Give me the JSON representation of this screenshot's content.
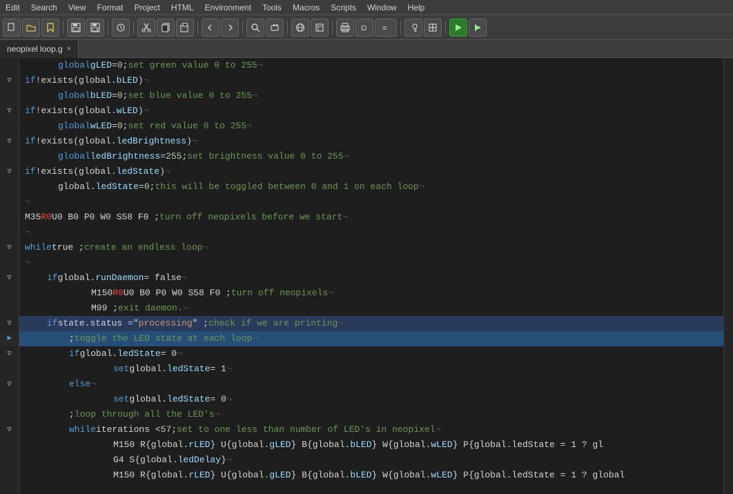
{
  "menubar": {
    "items": [
      "Edit",
      "Search",
      "View",
      "Format",
      "Project",
      "HTML",
      "Environment",
      "Tools",
      "Macros",
      "Scripts",
      "Window",
      "Help"
    ]
  },
  "toolbar": {
    "buttons": [
      "new",
      "open",
      "bookmark",
      "save",
      "saveas",
      "undo-history",
      "cut",
      "copy",
      "paste",
      "back",
      "forward",
      "search",
      "plugin",
      "browser",
      "tools1",
      "tools2",
      "tools3",
      "tools4",
      "tools5",
      "run",
      "run-more"
    ]
  },
  "tab": {
    "filename": "neopixel loop.g",
    "close_label": "×"
  },
  "code": {
    "lines": [
      {
        "indent": 1,
        "tokens": [
          {
            "t": "kw",
            "v": "global"
          },
          {
            "t": "plain",
            "v": " "
          },
          {
            "t": "var",
            "v": "gLED"
          },
          {
            "t": "plain",
            "v": " = "
          },
          {
            "t": "num",
            "v": "0"
          },
          {
            "t": "plain",
            "v": " ; "
          },
          {
            "t": "cmt",
            "v": "set green value 0 to 255"
          },
          {
            "t": "plain",
            "v": "¬"
          }
        ]
      },
      {
        "indent": 0,
        "fold": "▽",
        "tokens": [
          {
            "t": "kw",
            "v": "if"
          },
          {
            "t": "plain",
            "v": " !exists(global."
          },
          {
            "t": "var",
            "v": "bLED"
          },
          {
            "t": "plain",
            "v": ")¬"
          }
        ]
      },
      {
        "indent": 1,
        "tokens": [
          {
            "t": "kw",
            "v": "global"
          },
          {
            "t": "plain",
            "v": " "
          },
          {
            "t": "var",
            "v": "bLED"
          },
          {
            "t": "plain",
            "v": " = "
          },
          {
            "t": "num",
            "v": "0"
          },
          {
            "t": "plain",
            "v": " ; "
          },
          {
            "t": "cmt",
            "v": "set blue value 0 to 255"
          },
          {
            "t": "plain",
            "v": "¬"
          }
        ]
      },
      {
        "indent": 0,
        "fold": "▽",
        "tokens": [
          {
            "t": "kw",
            "v": "if"
          },
          {
            "t": "plain",
            "v": " !exists(global."
          },
          {
            "t": "var",
            "v": "wLED"
          },
          {
            "t": "plain",
            "v": ")¬"
          }
        ]
      },
      {
        "indent": 1,
        "tokens": [
          {
            "t": "kw",
            "v": "global"
          },
          {
            "t": "plain",
            "v": " "
          },
          {
            "t": "var",
            "v": "wLED"
          },
          {
            "t": "plain",
            "v": " = "
          },
          {
            "t": "num",
            "v": "0"
          },
          {
            "t": "plain",
            "v": " ; "
          },
          {
            "t": "cmt",
            "v": "set red value 0 to 255"
          },
          {
            "t": "plain",
            "v": "¬"
          }
        ]
      },
      {
        "indent": 0,
        "fold": "▽",
        "tokens": [
          {
            "t": "kw",
            "v": "if"
          },
          {
            "t": "plain",
            "v": " !exists(global."
          },
          {
            "t": "var",
            "v": "ledBrightness"
          },
          {
            "t": "plain",
            "v": ")¬"
          }
        ]
      },
      {
        "indent": 1,
        "tokens": [
          {
            "t": "kw",
            "v": "global"
          },
          {
            "t": "plain",
            "v": " "
          },
          {
            "t": "var",
            "v": "ledBrightness"
          },
          {
            "t": "plain",
            "v": " = "
          },
          {
            "t": "num",
            "v": "255"
          },
          {
            "t": "plain",
            "v": " ; "
          },
          {
            "t": "cmt",
            "v": "set brightness value 0 to 255"
          },
          {
            "t": "plain",
            "v": "¬"
          }
        ]
      },
      {
        "indent": 0,
        "fold": "▽",
        "tokens": [
          {
            "t": "kw",
            "v": "if"
          },
          {
            "t": "plain",
            "v": " !exists(global."
          },
          {
            "t": "var",
            "v": "ledState"
          },
          {
            "t": "plain",
            "v": ")¬"
          }
        ]
      },
      {
        "indent": 1,
        "tokens": [
          {
            "t": "plain",
            "v": "global."
          },
          {
            "t": "var",
            "v": "ledState"
          },
          {
            "t": "plain",
            "v": " = "
          },
          {
            "t": "num",
            "v": "0"
          },
          {
            "t": "plain",
            "v": " ; "
          },
          {
            "t": "cmt",
            "v": "this will be toggled between 0 and 1 on each loop"
          },
          {
            "t": "plain",
            "v": "¬"
          }
        ]
      },
      {
        "indent": 0,
        "tokens": [
          {
            "t": "plain",
            "v": "¬"
          }
        ]
      },
      {
        "indent": 0,
        "tokens": [
          {
            "t": "plain",
            "v": "M35 "
          },
          {
            "t": "kw-red",
            "v": "R0"
          },
          {
            "t": "plain",
            "v": " U0 B0 P0 W0 S58 F0  ; "
          },
          {
            "t": "cmt",
            "v": "turn off neopixels before we start"
          },
          {
            "t": "plain",
            "v": "¬"
          }
        ]
      },
      {
        "indent": 0,
        "tokens": [
          {
            "t": "plain",
            "v": "¬"
          }
        ]
      },
      {
        "indent": 0,
        "fold": "▽",
        "tokens": [
          {
            "t": "kw",
            "v": "while"
          },
          {
            "t": "plain",
            "v": " true ; "
          },
          {
            "t": "cmt",
            "v": "create an endless loop"
          },
          {
            "t": "plain",
            "v": "¬"
          }
        ]
      },
      {
        "indent": 0,
        "tokens": [
          {
            "t": "plain",
            "v": "¬"
          }
        ]
      },
      {
        "indent": 1,
        "fold": "▽",
        "tokens": [
          {
            "t": "kw",
            "v": "if"
          },
          {
            "t": "plain",
            "v": " global."
          },
          {
            "t": "var",
            "v": "runDaemon"
          },
          {
            "t": "plain",
            "v": " = false¬"
          }
        ]
      },
      {
        "indent": 2,
        "tokens": [
          {
            "t": "plain",
            "v": "M150 "
          },
          {
            "t": "kw-red",
            "v": "R0"
          },
          {
            "t": "plain",
            "v": " U0 B0 P0 W0 S58 F0  ; "
          },
          {
            "t": "cmt",
            "v": "turn off neopixels"
          },
          {
            "t": "plain",
            "v": "¬"
          }
        ]
      },
      {
        "indent": 2,
        "tokens": [
          {
            "t": "plain",
            "v": "M99 ; "
          },
          {
            "t": "cmt",
            "v": "exit daemon."
          },
          {
            "t": "plain",
            "v": "¬"
          }
        ]
      },
      {
        "indent": 1,
        "fold": "▽",
        "highlight": true,
        "tokens": [
          {
            "t": "kw",
            "v": "if"
          },
          {
            "t": "plain",
            "v": " state.status =\""
          },
          {
            "t": "str",
            "v": "processing"
          },
          {
            "t": "plain",
            "v": "\" ; "
          },
          {
            "t": "cmt",
            "v": "check if we are printing"
          },
          {
            "t": "plain",
            "v": "¬"
          }
        ]
      },
      {
        "indent": 2,
        "selected": true,
        "tokens": [
          {
            "t": "plain",
            "v": ";"
          },
          {
            "t": "cmt",
            "v": "toggle the LED state at each loop"
          },
          {
            "t": "plain",
            "v": "¬"
          }
        ]
      },
      {
        "indent": 2,
        "fold": "▽",
        "tokens": [
          {
            "t": "kw",
            "v": "if"
          },
          {
            "t": "plain",
            "v": " global."
          },
          {
            "t": "var",
            "v": "ledState"
          },
          {
            "t": "plain",
            "v": " = 0¬"
          }
        ]
      },
      {
        "indent": 3,
        "tokens": [
          {
            "t": "kw",
            "v": "set"
          },
          {
            "t": "plain",
            "v": " global."
          },
          {
            "t": "var",
            "v": "ledState"
          },
          {
            "t": "plain",
            "v": " = 1¬"
          }
        ]
      },
      {
        "indent": 2,
        "fold": "▽",
        "tokens": [
          {
            "t": "kw",
            "v": "else"
          },
          {
            "t": "plain",
            "v": "¬"
          }
        ]
      },
      {
        "indent": 3,
        "tokens": [
          {
            "t": "kw",
            "v": "set"
          },
          {
            "t": "plain",
            "v": " global."
          },
          {
            "t": "var",
            "v": "ledState"
          },
          {
            "t": "plain",
            "v": " = 0¬"
          }
        ]
      },
      {
        "indent": 2,
        "tokens": [
          {
            "t": "plain",
            "v": ";"
          },
          {
            "t": "cmt",
            "v": "loop through all the LED's"
          },
          {
            "t": "plain",
            "v": "¬"
          }
        ]
      },
      {
        "indent": 2,
        "fold": "▽",
        "tokens": [
          {
            "t": "kw",
            "v": "while"
          },
          {
            "t": "plain",
            "v": " iterations < "
          },
          {
            "t": "num",
            "v": "57"
          },
          {
            "t": "plain",
            "v": " ; "
          },
          {
            "t": "cmt",
            "v": "set to one less than number of LED's in neopixel"
          },
          {
            "t": "plain",
            "v": "¬"
          }
        ]
      },
      {
        "indent": 3,
        "tokens": [
          {
            "t": "plain",
            "v": "M150 R{global."
          },
          {
            "t": "var",
            "v": "rLED"
          },
          {
            "t": "plain",
            "v": "} U{global."
          },
          {
            "t": "var",
            "v": "gLED"
          },
          {
            "t": "plain",
            "v": "} B{global."
          },
          {
            "t": "var",
            "v": "bLED"
          },
          {
            "t": "plain",
            "v": "} W{global."
          },
          {
            "t": "var",
            "v": "wLED"
          },
          {
            "t": "plain",
            "v": "} P{global.ledState = 1 ? gl"
          }
        ]
      },
      {
        "indent": 3,
        "tokens": [
          {
            "t": "plain",
            "v": "G4 S{global."
          },
          {
            "t": "var",
            "v": "ledDelay"
          },
          {
            "t": "plain",
            "v": "}¬"
          }
        ]
      },
      {
        "indent": 3,
        "tokens": [
          {
            "t": "plain",
            "v": "M150 R{global."
          },
          {
            "t": "var",
            "v": "rLED"
          },
          {
            "t": "plain",
            "v": "} U{global."
          },
          {
            "t": "var",
            "v": "gLED"
          },
          {
            "t": "plain",
            "v": "} B{global."
          },
          {
            "t": "var",
            "v": "bLED"
          },
          {
            "t": "plain",
            "v": "} W{global."
          },
          {
            "t": "var",
            "v": "wLED"
          },
          {
            "t": "plain",
            "v": "} P{global.ledState = 1 ? global"
          }
        ]
      }
    ],
    "gutter_indicators": [
      "",
      "▽",
      "",
      "▽",
      "",
      "▽",
      "",
      "▽",
      "",
      "",
      "",
      "",
      "▽",
      "",
      "▽ if",
      "",
      "",
      "▽",
      "►",
      "▽",
      "",
      "▽",
      "",
      "",
      "▽",
      "",
      "",
      ""
    ]
  }
}
